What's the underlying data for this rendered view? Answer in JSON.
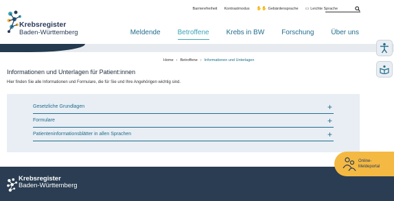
{
  "logo": {
    "line1": "Krebsregister",
    "line2": "Baden-Württemberg"
  },
  "utility": {
    "items": [
      "Barrierefreiheit",
      "Kontrastmodus",
      "Gebärdensprache",
      "Leichte Sprache"
    ]
  },
  "nav": {
    "items": [
      "Meldende",
      "Betroffene",
      "Krebs in BW",
      "Forschung",
      "Über uns"
    ],
    "active": "Betroffene"
  },
  "breadcrumb": [
    "Home",
    "Betroffene",
    "Informationen und Unterlagen"
  ],
  "page": {
    "title": "Informationen und Unterlagen für Patient:innen",
    "intro": "Hier finden Sie alle Informationen und Formulare, die für Sie und Ihre Angehörigen wichtig sind."
  },
  "accordion": [
    "Gesetzliche Grundlagen",
    "Formulare",
    "Patienteninformationsblätter in allen Sprachen"
  ],
  "online_portal": {
    "line1": "Online-",
    "line2": "Meldeportal"
  },
  "colors": {
    "primary": "#1f6b8c",
    "accent": "#3aa3b7",
    "footer": "#2a3d52",
    "cta": "#f4b942"
  }
}
